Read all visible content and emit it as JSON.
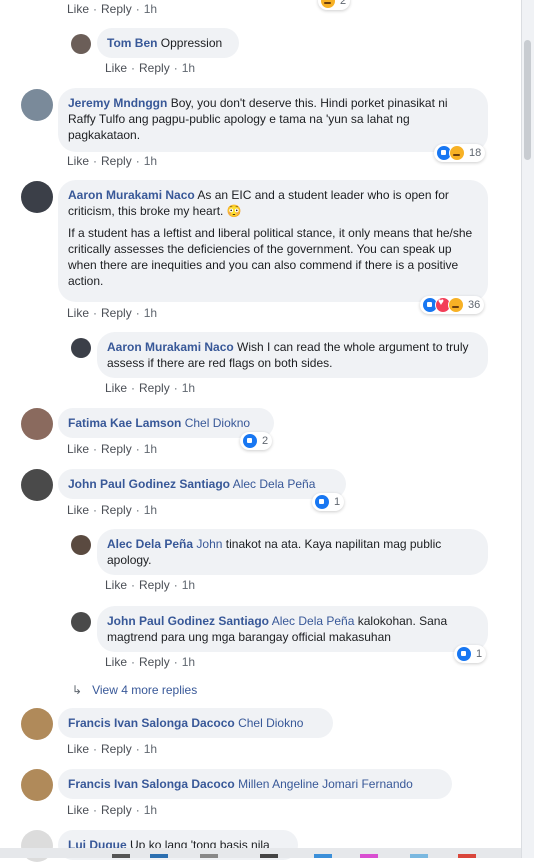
{
  "actions": {
    "like": "Like",
    "reply": "Reply",
    "time": "1h"
  },
  "top_reaction_count": "2",
  "comments": [
    {
      "name": "Tom Ben",
      "text": "Oppression"
    },
    {
      "name": "Jeremy Mndnggn",
      "text": "Boy, you don't deserve this. Hindi porket pinasikat ni Raffy Tulfo ang pagpu-public apology e tama na 'yun sa lahat ng pagkakataon.",
      "reactions": "18"
    },
    {
      "name": "Aaron Murakami Naco",
      "text": "As an EIC and a student leader who is open for criticism, this broke my heart. 😳",
      "text2": "If a student has a leftist and liberal political stance, it only means that he/she critically assesses the deficiencies of the government. You can speak up when there are inequities and you can also commend if there is a positive action.",
      "reactions": "36"
    },
    {
      "name": "Aaron Murakami Naco",
      "text": "Wish I can read the whole argument to truly assess if there are red flags on both sides."
    },
    {
      "name": "Fatima Kae Lamson",
      "tag": "Chel Diokno",
      "reactions": "2"
    },
    {
      "name": "John Paul Godinez Santiago",
      "tag": "Alec Dela Peña",
      "reactions": "1"
    },
    {
      "name": "Alec Dela Peña",
      "tag": "John",
      "text": "tinakot na ata. Kaya napilitan mag public apology."
    },
    {
      "name": "John Paul Godinez Santiago",
      "tag": "Alec Dela Peña",
      "text": "kalokohan. Sana magtrend para ung mga barangay official makasuhan",
      "reactions": "1"
    },
    {
      "name": "Francis Ivan Salonga Dacoco",
      "tag": "Chel Diokno"
    },
    {
      "name": "Francis Ivan Salonga Dacoco",
      "tag": "Millen Angeline Jomari Fernando"
    },
    {
      "name": "Lui Duque",
      "text": "Up ko lang 'tong basis nila"
    }
  ],
  "view_more": "View 4 more replies"
}
